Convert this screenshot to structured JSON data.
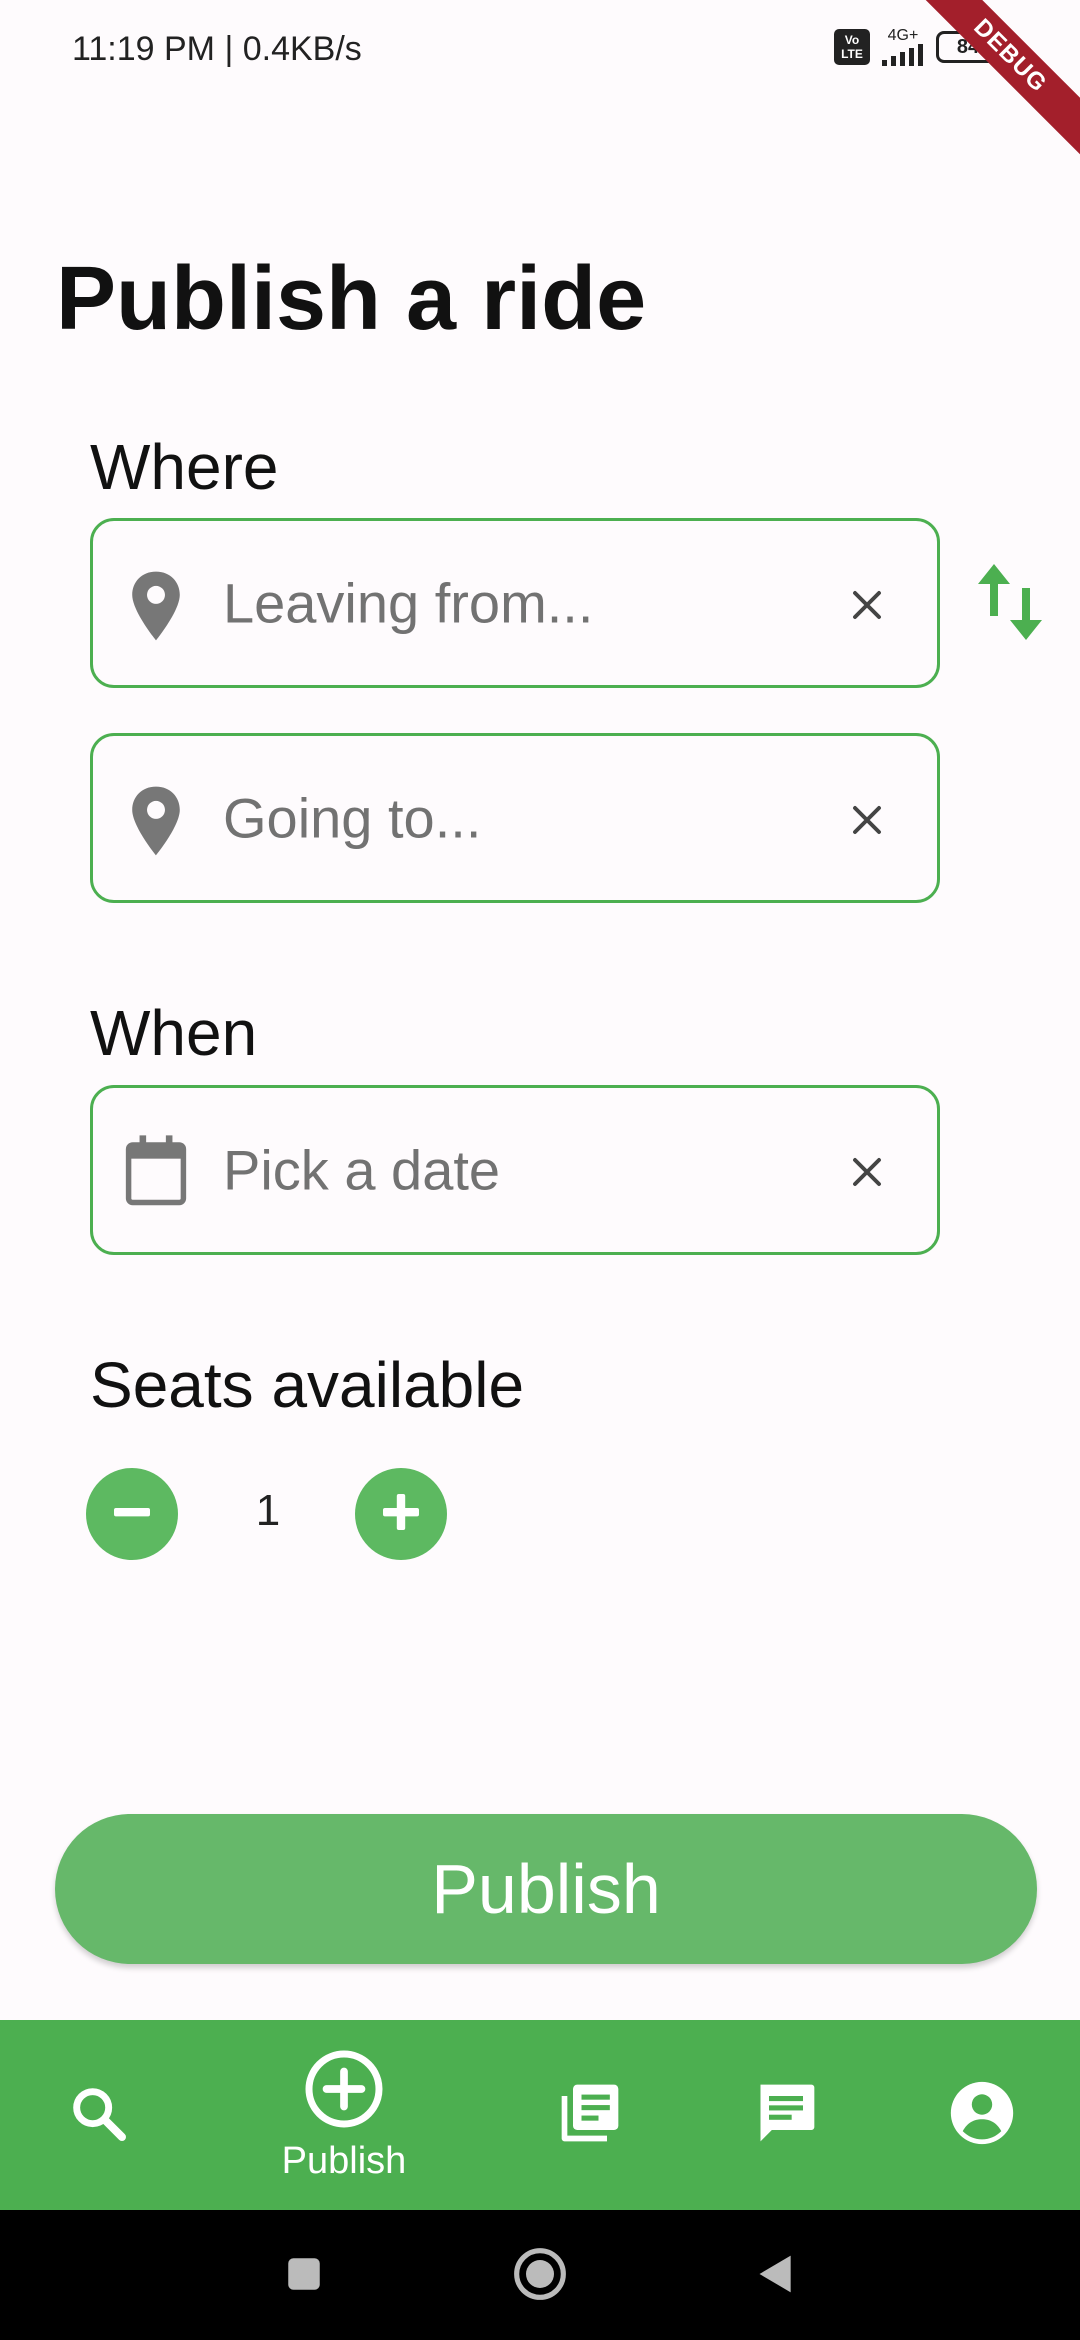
{
  "status_bar": {
    "time": "11:19 PM | 0.4KB/s",
    "volte": "Vo LTE",
    "network": "4G+",
    "battery": "84",
    "debug_banner": "DEBUG"
  },
  "page": {
    "title": "Publish a ride"
  },
  "where": {
    "label": "Where",
    "from_placeholder": "Leaving from...",
    "to_placeholder": "Going to..."
  },
  "when": {
    "label": "When",
    "date_placeholder": "Pick a date"
  },
  "seats": {
    "label": "Seats available",
    "count": "1"
  },
  "publish_button": {
    "label": "Publish"
  },
  "bottom_nav": {
    "items": [
      {
        "icon": "search-icon",
        "label": ""
      },
      {
        "icon": "add-circle-icon",
        "label": "Publish",
        "active": true
      },
      {
        "icon": "library-books-icon",
        "label": ""
      },
      {
        "icon": "chat-icon",
        "label": ""
      },
      {
        "icon": "account-circle-icon",
        "label": ""
      }
    ]
  },
  "colors": {
    "accent": "#4caf50",
    "button": "#66b86a",
    "stepper": "#5db961",
    "background": "#fefbfd",
    "debug_ribbon": "#a31f2b"
  }
}
